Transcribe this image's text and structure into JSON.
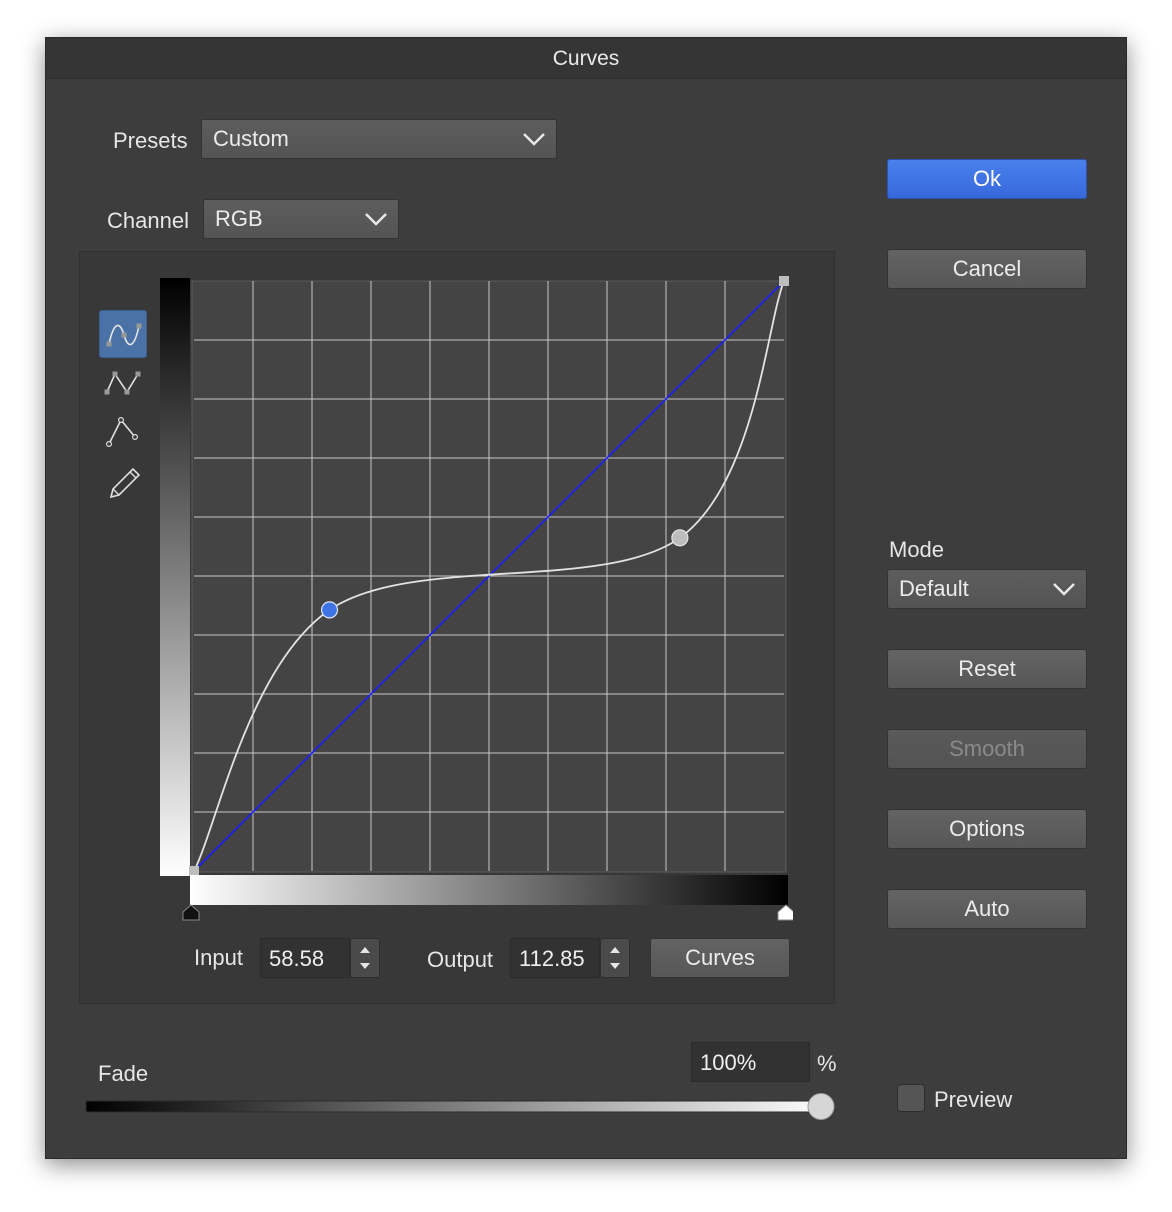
{
  "window": {
    "title": "Curves"
  },
  "presets": {
    "label": "Presets",
    "value": "Custom"
  },
  "channel": {
    "label": "Channel",
    "value": "RGB"
  },
  "buttons": {
    "ok": "Ok",
    "cancel": "Cancel",
    "reset": "Reset",
    "smooth": "Smooth",
    "options": "Options",
    "auto": "Auto",
    "curves": "Curves"
  },
  "mode": {
    "label": "Mode",
    "value": "Default"
  },
  "tools": [
    "smooth-curve-icon",
    "corner-curve-icon",
    "linear-curve-icon",
    "pencil-icon"
  ],
  "curve": {
    "control_points": [
      {
        "input": 0,
        "output": 0
      },
      {
        "input": 58.58,
        "output": 112.85,
        "selected": true
      },
      {
        "input": 210,
        "output": 144
      },
      {
        "input": 255,
        "output": 255
      }
    ]
  },
  "input": {
    "label": "Input",
    "value": "58.58"
  },
  "output": {
    "label": "Output",
    "value": "112.85"
  },
  "fade": {
    "label": "Fade",
    "value": "100%",
    "unit": "%",
    "level": 1.0
  },
  "preview": {
    "label": "Preview",
    "checked": false
  },
  "colors": {
    "accent": "#3f74e4",
    "diagonal": "#1c1cff",
    "curve": "#e2e2e2",
    "selected_point": "#3f74e4"
  }
}
